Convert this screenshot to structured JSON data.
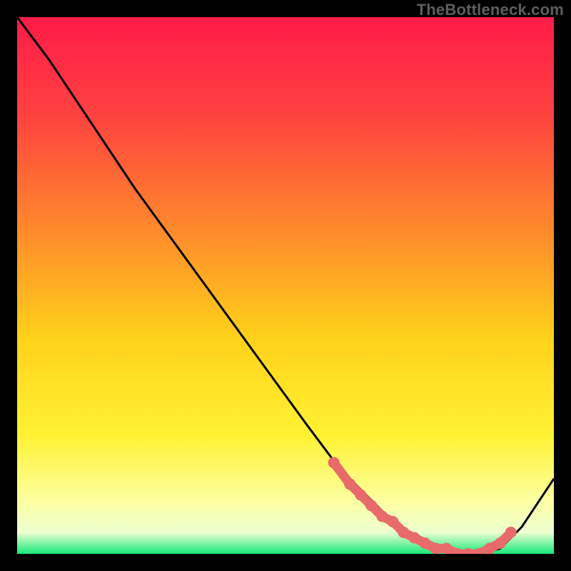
{
  "attribution": "TheBottleneck.com",
  "chart_data": {
    "type": "line",
    "title": "",
    "xlabel": "",
    "ylabel": "",
    "xlim": [
      0,
      100
    ],
    "ylim": [
      0,
      100
    ],
    "grid": false,
    "series": [
      {
        "name": "curve",
        "x": [
          0,
          6,
          14,
          22,
          30,
          38,
          46,
          54,
          60,
          66,
          70,
          74,
          78,
          82,
          86,
          90,
          94,
          100
        ],
        "y": [
          100,
          92,
          80,
          68,
          57,
          46,
          35,
          24,
          16,
          10,
          6,
          3,
          1,
          0,
          0,
          1,
          5,
          14
        ]
      }
    ],
    "markers": {
      "name": "highlight-dots",
      "x": [
        59,
        62,
        64,
        66,
        68,
        70,
        72,
        74,
        76,
        78,
        80,
        82,
        84,
        86,
        88,
        90,
        92
      ],
      "y": [
        17,
        13,
        11,
        9,
        7,
        6,
        4,
        3,
        2,
        1,
        1,
        0,
        0,
        0,
        1,
        2,
        4
      ]
    },
    "gradient_stops": [
      {
        "offset": 0.0,
        "color": "#ff1b49"
      },
      {
        "offset": 0.18,
        "color": "#ff4140"
      },
      {
        "offset": 0.4,
        "color": "#ff8b2b"
      },
      {
        "offset": 0.6,
        "color": "#ffd21a"
      },
      {
        "offset": 0.78,
        "color": "#fff233"
      },
      {
        "offset": 0.9,
        "color": "#fdffa0"
      },
      {
        "offset": 0.96,
        "color": "#ecffd0"
      },
      {
        "offset": 1.0,
        "color": "#16e87a"
      }
    ],
    "marker_color": "#e96a6a",
    "curve_color": "#000000"
  }
}
